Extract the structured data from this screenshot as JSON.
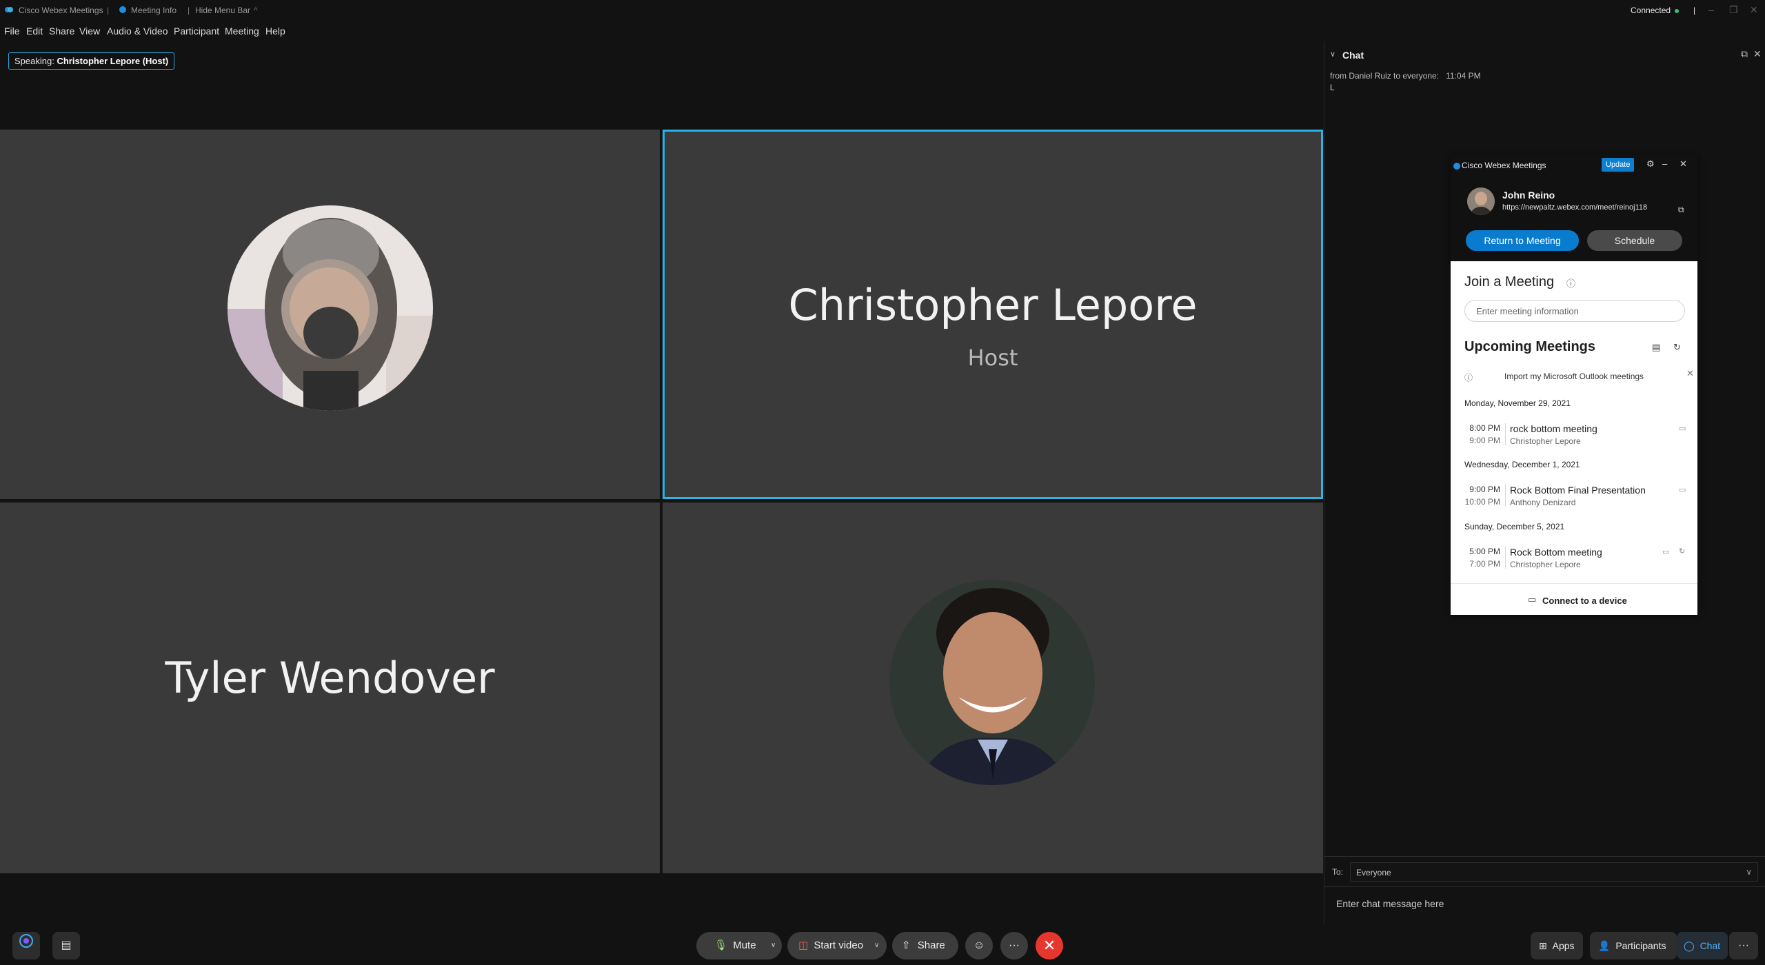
{
  "titlebar": {
    "app_name": "Cisco Webex Meetings",
    "meeting_info": "Meeting Info",
    "hide_menu_bar": "Hide Menu Bar",
    "status": "Connected",
    "status_color": "#3cc26a"
  },
  "menu": [
    "File",
    "Edit",
    "Share",
    "View",
    "Audio & Video",
    "Participant",
    "Meeting",
    "Help"
  ],
  "speaking": {
    "label": "Speaking:",
    "name": "Christopher Lepore (Host)"
  },
  "tiles": {
    "host_name": "Christopher Lepore",
    "host_role": "Host",
    "tyler_name": "Tyler Wendover"
  },
  "chat": {
    "title": "Chat",
    "message_meta": "from Daniel Ruiz to everyone:",
    "message_time": "11:04 PM",
    "message_text": "L",
    "to_label": "To:",
    "to_value": "Everyone",
    "input_placeholder": "Enter chat message here"
  },
  "popup": {
    "app_name": "Cisco Webex Meetings",
    "update_label": "Update",
    "user_name": "John Reino",
    "user_url": "https://newpaltz.webex.com/meet/reinoj118",
    "return_button": "Return to Meeting",
    "schedule_button": "Schedule",
    "join_title": "Join a Meeting",
    "join_placeholder": "Enter meeting information",
    "upcoming_title": "Upcoming Meetings",
    "outlook_import": "Import my Microsoft Outlook meetings",
    "days": [
      {
        "date": "Monday, November 29, 2021",
        "meetings": [
          {
            "start": "8:00 PM",
            "end": "9:00 PM",
            "title": "rock bottom meeting",
            "host": "Christopher Lepore"
          }
        ]
      },
      {
        "date": "Wednesday, December 1, 2021",
        "meetings": [
          {
            "start": "9:00 PM",
            "end": "10:00 PM",
            "title": "Rock Bottom Final Presentation",
            "host": "Anthony Denizard"
          }
        ]
      },
      {
        "date": "Sunday, December 5, 2021",
        "meetings": [
          {
            "start": "5:00 PM",
            "end": "7:00 PM",
            "title": "Rock Bottom meeting",
            "host": "Christopher Lepore"
          }
        ]
      }
    ],
    "connect_device": "Connect to a device",
    "accent_color": "#0a7ccf"
  },
  "controls": {
    "mute": "Mute",
    "start_video": "Start video",
    "share": "Share",
    "apps": "Apps",
    "participants": "Participants",
    "chat": "Chat",
    "end_color": "#e6372f"
  },
  "colors": {
    "active_speaker_border": "#26b5e6",
    "tile_bg": "#3a3a3a"
  }
}
